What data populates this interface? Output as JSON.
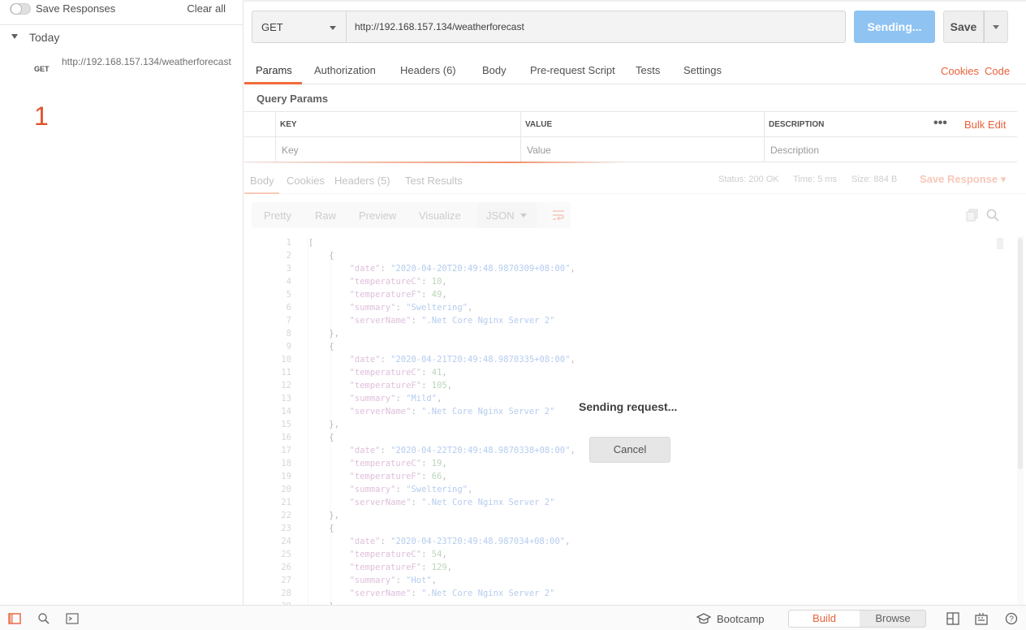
{
  "sidebar": {
    "save_responses_label": "Save Responses",
    "save_responses_on": false,
    "clear_all_label": "Clear all",
    "group_label": "Today",
    "history": [
      {
        "method": "GET",
        "url": "http://192.168.157.134/weatherforecast"
      }
    ],
    "annotation": "1"
  },
  "request": {
    "method": "GET",
    "url": "http://192.168.157.134/weatherforecast",
    "send_label": "Sending...",
    "save_label": "Save"
  },
  "tabs": {
    "params": "Params",
    "authorization": "Authorization",
    "headers": "Headers (6)",
    "body": "Body",
    "prerequest": "Pre-request Script",
    "tests": "Tests",
    "settings": "Settings",
    "cookies_link": "Cookies",
    "code_link": "Code"
  },
  "params": {
    "section_label": "Query Params",
    "columns": {
      "key": "KEY",
      "value": "VALUE",
      "description": "DESCRIPTION"
    },
    "more_label": "•••",
    "bulk_edit_label": "Bulk Edit",
    "placeholders": {
      "key": "Key",
      "value": "Value",
      "description": "Description"
    }
  },
  "response": {
    "tabs": {
      "body": "Body",
      "cookies": "Cookies",
      "headers": "Headers (5)",
      "test_results": "Test Results"
    },
    "status": "Status: 200 OK",
    "time": "Time: 5 ms",
    "size": "Size: 884 B",
    "save_response_label": "Save Response",
    "view_modes": [
      "Pretty",
      "Raw",
      "Preview",
      "Visualize"
    ],
    "format": "JSON",
    "code_lines": [
      "[",
      "    {",
      "        \"date\": \"2020-04-20T20:49:48.9870309+08:00\",",
      "        \"temperatureC\": 10,",
      "        \"temperatureF\": 49,",
      "        \"summary\": \"Sweltering\",",
      "        \"serverName\": \".Net Core Nginx Server 2\"",
      "    },",
      "    {",
      "        \"date\": \"2020-04-21T20:49:48.9870335+08:00\",",
      "        \"temperatureC\": 41,",
      "        \"temperatureF\": 105,",
      "        \"summary\": \"Mild\",",
      "        \"serverName\": \".Net Core Nginx Server 2\"",
      "    },",
      "    {",
      "        \"date\": \"2020-04-22T20:49:48.9870338+08:00\",",
      "        \"temperatureC\": 19,",
      "        \"temperatureF\": 66,",
      "        \"summary\": \"Sweltering\",",
      "        \"serverName\": \".Net Core Nginx Server 2\"",
      "    },",
      "    {",
      "        \"date\": \"2020-04-23T20:49:48.987034+08:00\",",
      "        \"temperatureC\": 54,",
      "        \"temperatureF\": 129,",
      "        \"summary\": \"Hot\",",
      "        \"serverName\": \".Net Core Nginx Server 2\"",
      "    },"
    ]
  },
  "overlay": {
    "message": "Sending request...",
    "cancel_label": "Cancel"
  },
  "footer": {
    "bootcamp_label": "Bootcamp",
    "build_label": "Build",
    "browse_label": "Browse"
  },
  "colors": {
    "accent": "#f26b3a",
    "send_button": "#8fc3f2",
    "annotation": "#e0522e"
  }
}
